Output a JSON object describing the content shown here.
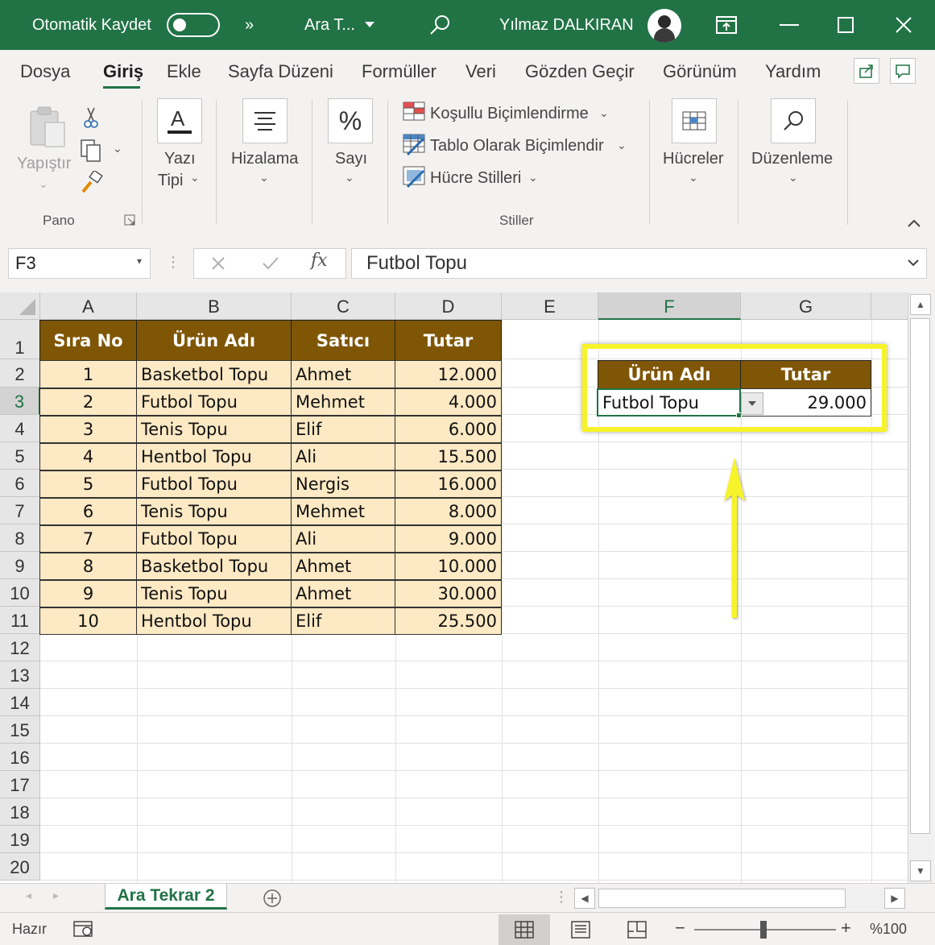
{
  "titlebar": {
    "autosave_label": "Otomatik Kaydet",
    "overflow": "»",
    "doc_title": "Ara T...",
    "user_name": "Yılmaz DALKIRAN",
    "bg_color": "#217346"
  },
  "menu": {
    "items": [
      "Dosya",
      "Giriş",
      "Ekle",
      "Sayfa Düzeni",
      "Formüller",
      "Veri",
      "Gözden Geçir",
      "Görünüm",
      "Yardım"
    ],
    "active": "Giriş"
  },
  "ribbon": {
    "paste": "Yapıştır",
    "pano": "Pano",
    "font_line1": "Yazı",
    "font_line2": "Tipi",
    "align": "Hizalama",
    "number": "Sayı",
    "cond_format": "Koşullu Biçimlendirme",
    "table_format": "Tablo Olarak Biçimlendir",
    "cell_styles": "Hücre Stilleri",
    "styles_group": "Stiller",
    "cells": "Hücreler",
    "editing": "Düzenleme"
  },
  "formula_bar": {
    "name_box": "F3",
    "fx": "fx",
    "content": "Futbol Topu"
  },
  "columns": [
    "A",
    "B",
    "C",
    "D",
    "E",
    "F",
    "G"
  ],
  "rows": [
    "1",
    "2",
    "3",
    "4",
    "5",
    "6",
    "7",
    "8",
    "9",
    "10",
    "11",
    "12",
    "13",
    "14",
    "15",
    "16",
    "17",
    "18",
    "19",
    "20"
  ],
  "table": {
    "headers": [
      "Sıra No",
      "Ürün Adı",
      "Satıcı",
      "Tutar"
    ],
    "rows": [
      [
        "1",
        "Basketbol Topu",
        "Ahmet",
        "12.000"
      ],
      [
        "2",
        "Futbol Topu",
        "Mehmet",
        "4.000"
      ],
      [
        "3",
        "Tenis Topu",
        "Elif",
        "6.000"
      ],
      [
        "4",
        "Hentbol Topu",
        "Ali",
        "15.500"
      ],
      [
        "5",
        "Futbol Topu",
        "Nergis",
        "16.000"
      ],
      [
        "6",
        "Tenis Topu",
        "Mehmet",
        "8.000"
      ],
      [
        "7",
        "Futbol Topu",
        "Ali",
        "9.000"
      ],
      [
        "8",
        "Basketbol Topu",
        "Ahmet",
        "10.000"
      ],
      [
        "9",
        "Tenis Topu",
        "Ahmet",
        "30.000"
      ],
      [
        "10",
        "Hentbol Topu",
        "Elif",
        "25.500"
      ]
    ]
  },
  "lookup": {
    "header_product": "Ürün Adı",
    "header_amount": "Tutar",
    "product": "Futbol Topu",
    "amount": "29.000"
  },
  "sheet_tab": "Ara Tekrar 2",
  "status": {
    "ready": "Hazır",
    "minus": "−",
    "plus": "+",
    "zoom": "%100"
  },
  "colors": {
    "header_bg": "#7f5605",
    "data_bg": "#fde9c4",
    "highlight": "#f6f32a",
    "accent": "#217346"
  }
}
